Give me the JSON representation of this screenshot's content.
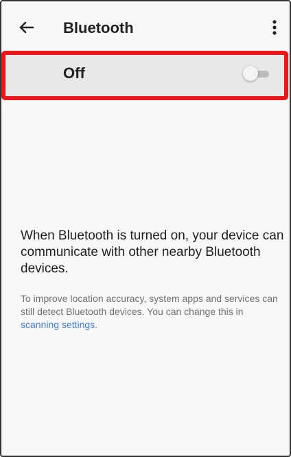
{
  "header": {
    "title": "Bluetooth",
    "back_icon": "arrow-left-icon",
    "menu_icon": "more-vert-icon"
  },
  "toggle": {
    "label": "Off",
    "state": "off"
  },
  "info": {
    "main": "When Bluetooth is turned on, your device can communicate with other nearby Bluetooth devices.",
    "sub_prefix": "To improve location accuracy, system apps and services can still detect Bluetooth devices. You can change this in ",
    "link": "scanning settings",
    "sub_suffix": "."
  },
  "colors": {
    "highlight": "#e8171a",
    "link": "#3f7fd6"
  }
}
